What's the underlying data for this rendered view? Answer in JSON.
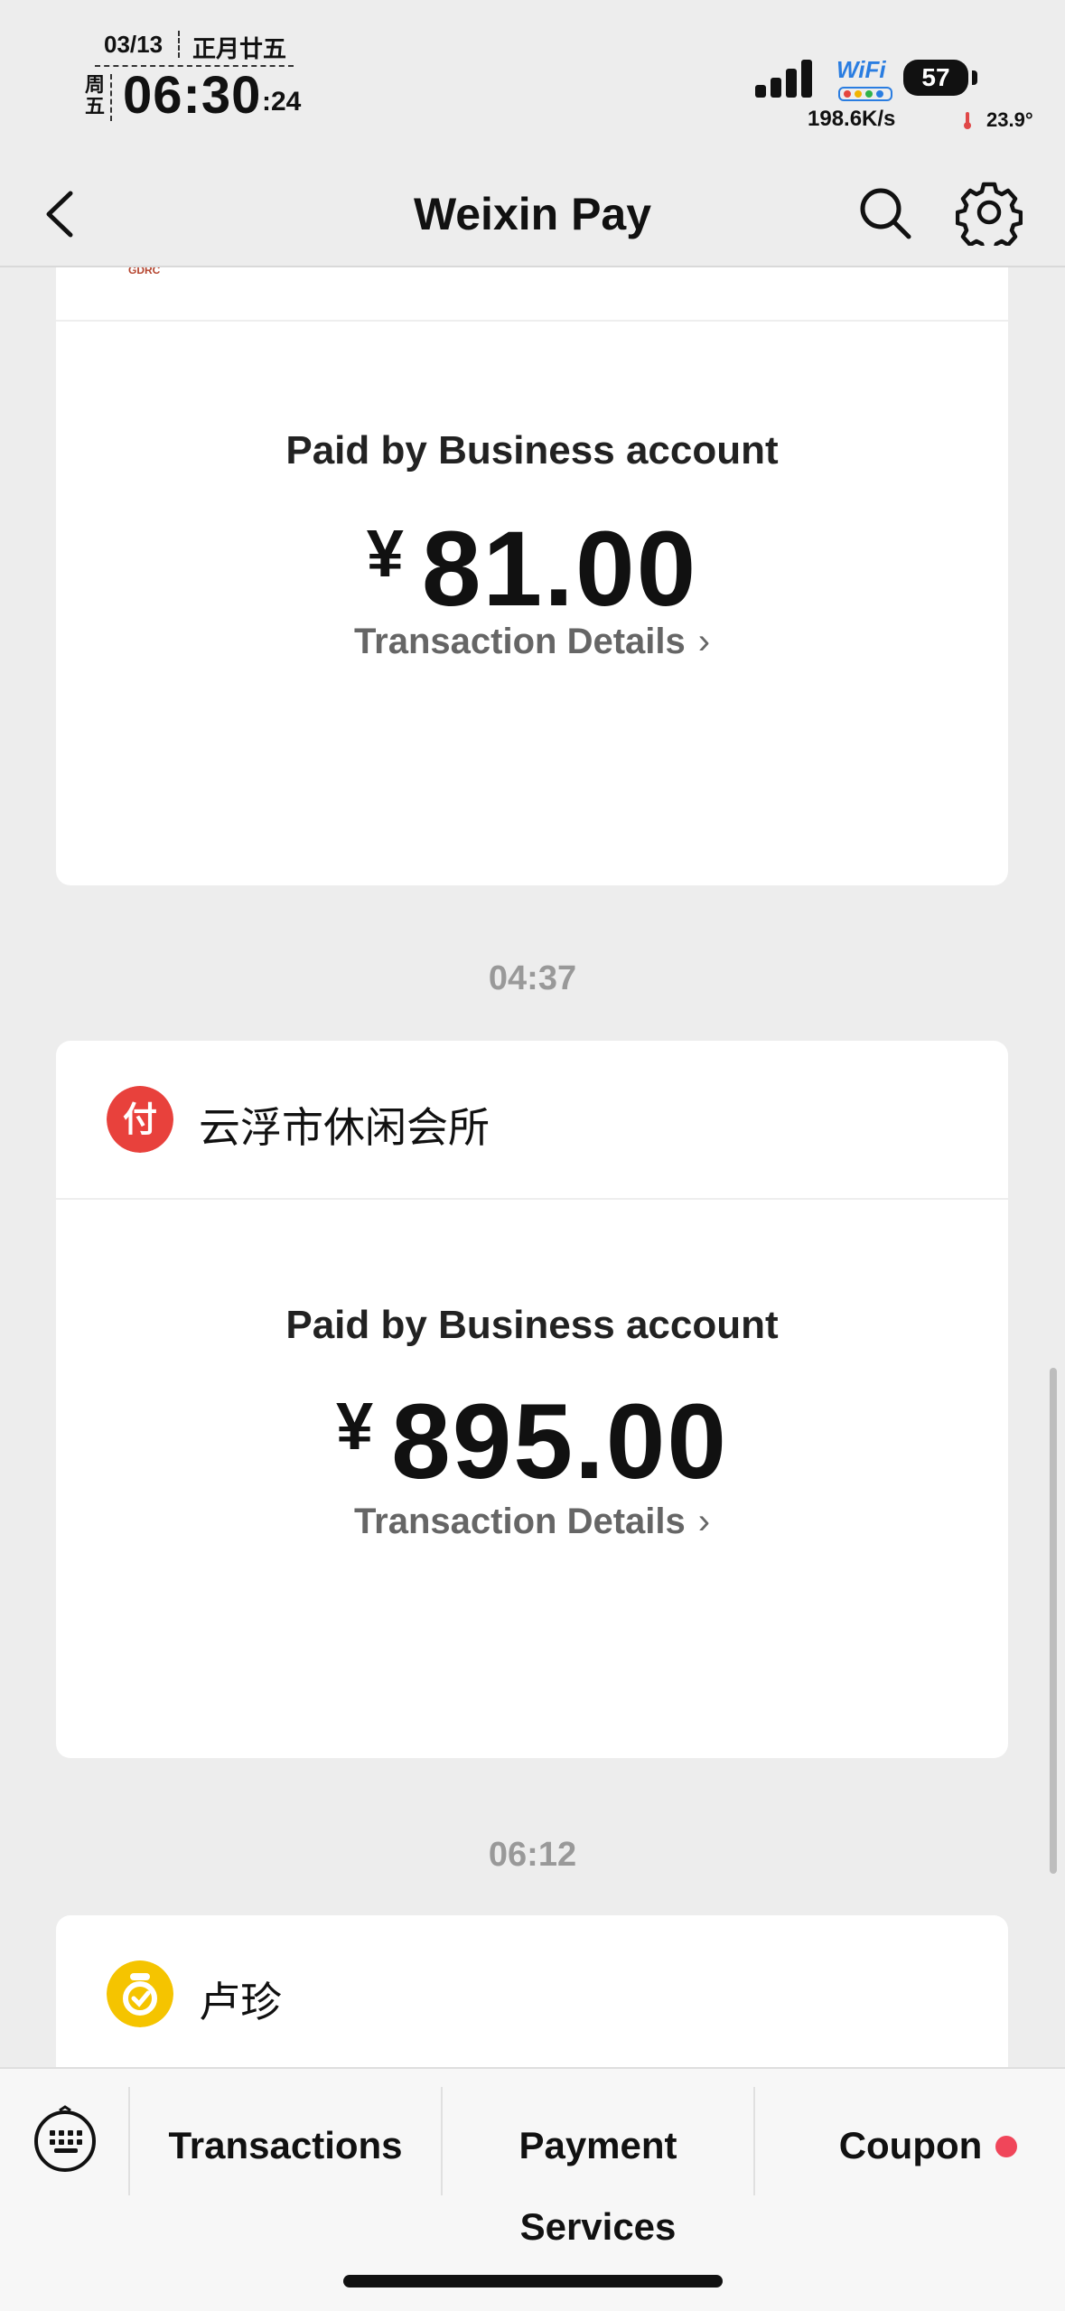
{
  "status_bar": {
    "date": "03/13",
    "lunar_date": "正月廿五",
    "weekday": "周五",
    "time": "06:30",
    "seconds": ":24",
    "wifi_label": "WiFi",
    "battery": "57",
    "net_speed": "198.6K/s",
    "temperature": "23.9°"
  },
  "nav": {
    "title": "Weixin Pay",
    "back_icon": "chevron-left-icon",
    "search_icon": "search-icon",
    "settings_icon": "gear-icon"
  },
  "cards": [
    {
      "merchant_logo_text": "GDRC",
      "pay_label": "Paid by Business account",
      "currency": "¥",
      "amount": "81.00",
      "details_label": "Transaction Details"
    },
    {
      "time": "04:37",
      "merchant_name": "云浮市休闲会所",
      "merchant_icon_char": "付",
      "pay_label": "Paid by Business account",
      "currency": "¥",
      "amount": "895.00",
      "details_label": "Transaction Details"
    },
    {
      "time": "06:12",
      "merchant_name": "卢珍"
    }
  ],
  "bottom_bar": {
    "keyboard_icon": "keyboard-icon",
    "tabs": [
      "Transactions",
      "Payment Services",
      "Coupon"
    ],
    "coupon_badge": "red-dot"
  },
  "colors": {
    "background": "#ededed",
    "card": "#ffffff",
    "merchant_red": "#e8413c",
    "merchant_yellow": "#f5c400",
    "badge_red": "#f0465a"
  }
}
